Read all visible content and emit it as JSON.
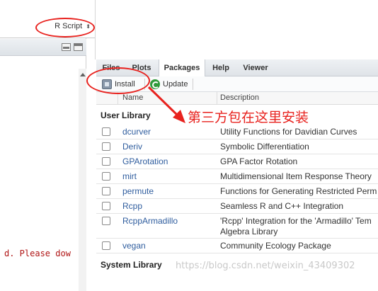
{
  "editor": {
    "script_type": "R Script",
    "script_type_arrows": "⬍"
  },
  "console": {
    "error_fragment": "d. Please dow"
  },
  "packages_pane": {
    "tabs": [
      {
        "label": "Files"
      },
      {
        "label": "Plots"
      },
      {
        "label": "Packages"
      },
      {
        "label": "Help"
      },
      {
        "label": "Viewer"
      }
    ],
    "active_tab": "Packages",
    "toolbar": {
      "install_label": "Install",
      "update_label": "Update"
    },
    "columns": {
      "name": "Name",
      "description": "Description"
    },
    "user_library_label": "User Library",
    "system_library_label": "System Library",
    "user_packages": [
      {
        "name": "dcurver",
        "description": "Utility Functions for Davidian Curves"
      },
      {
        "name": "Deriv",
        "description": "Symbolic Differentiation"
      },
      {
        "name": "GPArotation",
        "description": "GPA Factor Rotation"
      },
      {
        "name": "mirt",
        "description": "Multidimensional Item Response Theory"
      },
      {
        "name": "permute",
        "description": "Functions for Generating Restricted Perm"
      },
      {
        "name": "Rcpp",
        "description": "Seamless R and C++ Integration"
      },
      {
        "name": "RcppArmadillo",
        "description": "'Rcpp' Integration for the 'Armadillo' Tem Algebra Library"
      },
      {
        "name": "vegan",
        "description": "Community Ecology Package"
      }
    ]
  },
  "annotation": {
    "text": "第三方包在这里安装",
    "color": "#e8221e"
  },
  "watermark": "https://blog.csdn.net/weixin_43409302"
}
